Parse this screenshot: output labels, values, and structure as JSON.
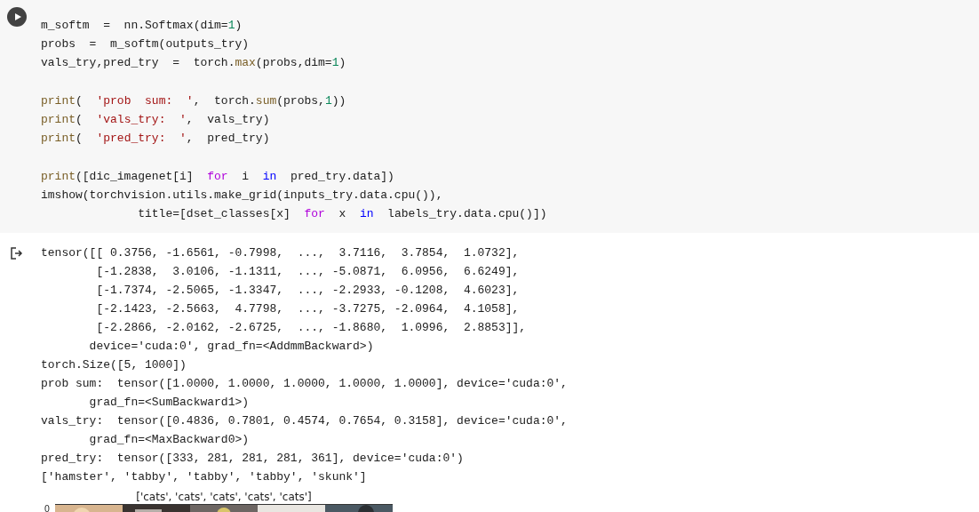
{
  "code_cell": {
    "blocks": [
      {
        "lines": [
          [
            {
              "text": "m_softm  =  nn.Softmax(dim=",
              "kind": "plain"
            },
            {
              "text": "1",
              "kind": "number"
            },
            {
              "text": ")",
              "kind": "plain"
            }
          ],
          [
            {
              "text": "probs  =  m_softm(outputs_try)",
              "kind": "plain"
            }
          ],
          [
            {
              "text": "vals_try,pred_try  =  torch.",
              "kind": "plain"
            },
            {
              "text": "max",
              "kind": "builtin"
            },
            {
              "text": "(probs,dim=",
              "kind": "plain"
            },
            {
              "text": "1",
              "kind": "number"
            },
            {
              "text": ")",
              "kind": "plain"
            }
          ]
        ]
      },
      {
        "lines": [
          [
            {
              "text": "print",
              "kind": "builtin"
            },
            {
              "text": "(  ",
              "kind": "plain"
            },
            {
              "text": "'prob  sum:  '",
              "kind": "string"
            },
            {
              "text": ",  torch.",
              "kind": "plain"
            },
            {
              "text": "sum",
              "kind": "builtin"
            },
            {
              "text": "(probs,",
              "kind": "plain"
            },
            {
              "text": "1",
              "kind": "number"
            },
            {
              "text": "))",
              "kind": "plain"
            }
          ],
          [
            {
              "text": "print",
              "kind": "builtin"
            },
            {
              "text": "(  ",
              "kind": "plain"
            },
            {
              "text": "'vals_try:  '",
              "kind": "string"
            },
            {
              "text": ",  vals_try)",
              "kind": "plain"
            }
          ],
          [
            {
              "text": "print",
              "kind": "builtin"
            },
            {
              "text": "(  ",
              "kind": "plain"
            },
            {
              "text": "'pred_try:  '",
              "kind": "string"
            },
            {
              "text": ",  pred_try)",
              "kind": "plain"
            }
          ]
        ]
      },
      {
        "lines": [
          [
            {
              "text": "print",
              "kind": "builtin"
            },
            {
              "text": "([dic_imagenet[i]  ",
              "kind": "plain"
            },
            {
              "text": "for",
              "kind": "keyword"
            },
            {
              "text": "  i  ",
              "kind": "plain"
            },
            {
              "text": "in",
              "kind": "operator"
            },
            {
              "text": "  pred_try.data])",
              "kind": "plain"
            }
          ],
          [
            {
              "text": "imshow(torchvision.utils.make_grid(inputs_try.data.cpu()),",
              "kind": "plain"
            }
          ],
          [
            {
              "text": "              title=[dset_classes[x]  ",
              "kind": "plain"
            },
            {
              "text": "for",
              "kind": "keyword"
            },
            {
              "text": "  x  ",
              "kind": "plain"
            },
            {
              "text": "in",
              "kind": "operator"
            },
            {
              "text": "  labels_try.data.cpu()])",
              "kind": "plain"
            }
          ]
        ]
      }
    ]
  },
  "output": {
    "lines": [
      "tensor([[ 0.3756, -1.6561, -0.7998,  ...,  3.7116,  3.7854,  1.0732],",
      "        [-1.2838,  3.0106, -1.1311,  ..., -5.0871,  6.0956,  6.6249],",
      "        [-1.7374, -2.5065, -1.3347,  ..., -2.2933, -0.1208,  4.6023],",
      "        [-2.1423, -2.5663,  4.7798,  ..., -3.7275, -2.0964,  4.1058],",
      "        [-2.2866, -2.0162, -2.6725,  ..., -1.8680,  1.0996,  2.8853]],",
      "       device='cuda:0', grad_fn=<AddmmBackward>)",
      "torch.Size([5, 1000])",
      "prob sum:  tensor([1.0000, 1.0000, 1.0000, 1.0000, 1.0000], device='cuda:0',",
      "       grad_fn=<SumBackward1>)",
      "vals_try:  tensor([0.4836, 0.7801, 0.4574, 0.7654, 0.3158], device='cuda:0',",
      "       grad_fn=<MaxBackward0>)",
      "pred_try:  tensor([333, 281, 281, 281, 361], device='cuda:0')",
      "['hamster', 'tabby', 'tabby', 'tabby', 'skunk']"
    ],
    "plot": {
      "title": "['cats', 'cats', 'cats', 'cats', 'cats']",
      "y_tick": "0"
    }
  }
}
